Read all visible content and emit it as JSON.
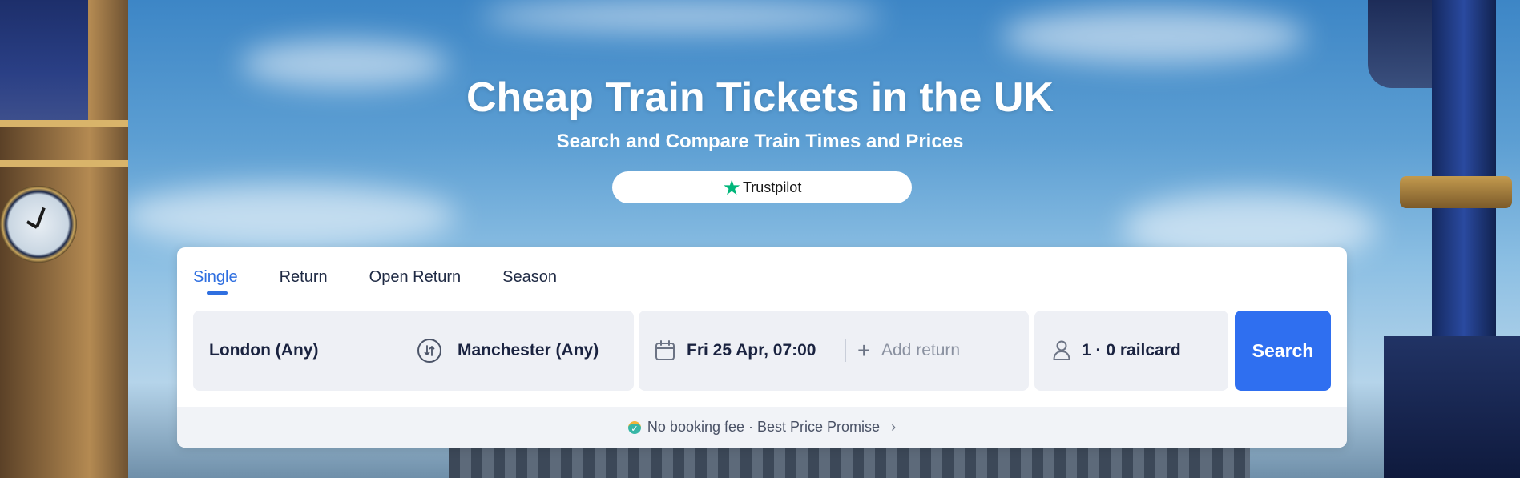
{
  "hero": {
    "title": "Cheap Train Tickets in the UK",
    "subtitle": "Search and Compare Train Times and Prices",
    "trustpilot_label": "Trustpilot"
  },
  "search": {
    "tabs": [
      {
        "label": "Single",
        "active": true
      },
      {
        "label": "Return",
        "active": false
      },
      {
        "label": "Open Return",
        "active": false
      },
      {
        "label": "Season",
        "active": false
      }
    ],
    "from": "London (Any)",
    "to": "Manchester (Any)",
    "outbound": "Fri 25 Apr, 07:00",
    "add_return": "Add return",
    "passengers": "1 · 0 railcard",
    "button": "Search"
  },
  "promo": {
    "text": "No booking fee · Best Price Promise"
  },
  "colors": {
    "accent": "#2f6ff0",
    "trustpilot_star": "#00b67a"
  },
  "icons": [
    "trustpilot-star-icon",
    "swap-icon",
    "calendar-icon",
    "plus-icon",
    "person-icon",
    "badge-icon",
    "chevron-right-icon"
  ]
}
